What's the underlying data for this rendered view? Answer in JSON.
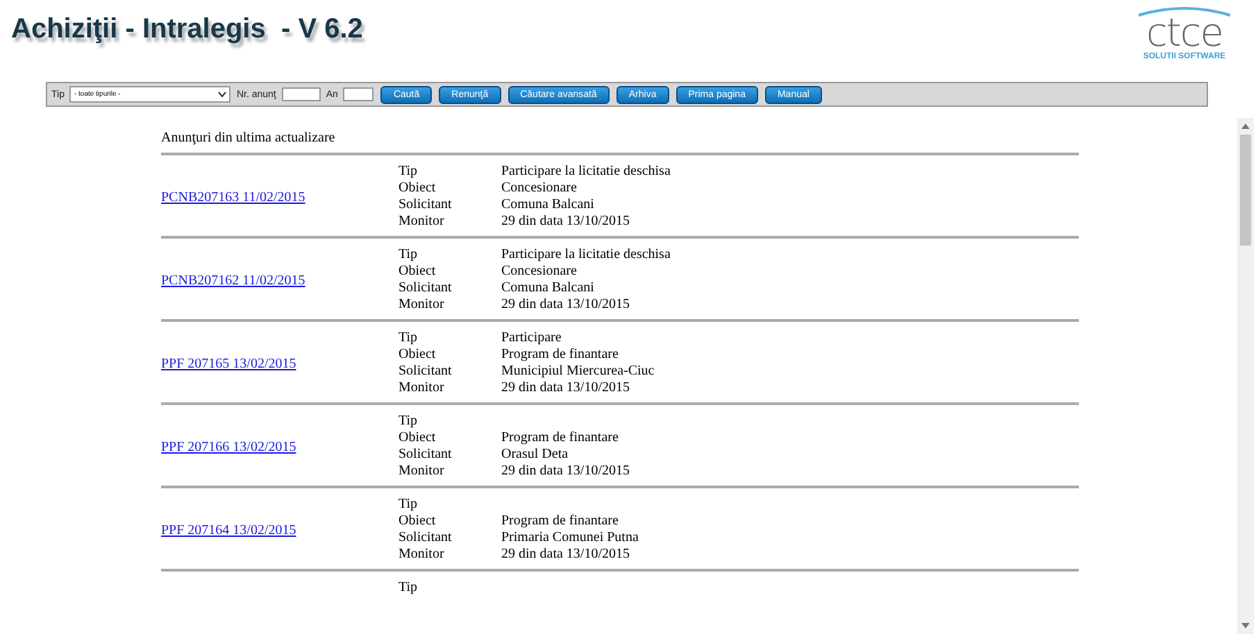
{
  "header": {
    "title": "Achiziţii - Intralegis  - V 6.2",
    "logo": {
      "name": "ctce",
      "tagline": "SOLUTII SOFTWARE"
    }
  },
  "toolbar": {
    "type_label": "Tip",
    "type_value": "- toate tipurile -",
    "number_label": "Nr. anunţ",
    "year_label": "An",
    "buttons": [
      "Caută",
      "Renunţă",
      "Căutare avansată",
      "Arhiva",
      "Prima pagina",
      "Manual"
    ]
  },
  "content": {
    "heading": "Anunţuri din ultima actualizare",
    "entries": [
      {
        "link": "PCNB207163 11/02/2015",
        "fields": [
          {
            "label": "Tip",
            "value": "Participare la licitatie deschisa"
          },
          {
            "label": "Obiect",
            "value": "Concesionare"
          },
          {
            "label": "Solicitant",
            "value": "Comuna Balcani"
          },
          {
            "label": "Monitor",
            "value": "29 din data 13/10/2015"
          }
        ]
      },
      {
        "link": "PCNB207162 11/02/2015",
        "fields": [
          {
            "label": "Tip",
            "value": "Participare la licitatie deschisa"
          },
          {
            "label": "Obiect",
            "value": "Concesionare"
          },
          {
            "label": "Solicitant",
            "value": "Comuna Balcani"
          },
          {
            "label": "Monitor",
            "value": "29 din data 13/10/2015"
          }
        ]
      },
      {
        "link": "PPF 207165 13/02/2015",
        "fields": [
          {
            "label": "Tip",
            "value": "Participare"
          },
          {
            "label": "Obiect",
            "value": "Program de finantare"
          },
          {
            "label": "Solicitant",
            "value": "Municipiul Miercurea-Ciuc"
          },
          {
            "label": "Monitor",
            "value": "29 din data 13/10/2015"
          }
        ]
      },
      {
        "link": "PPF 207166 13/02/2015",
        "fields": [
          {
            "label": "Tip"
          },
          {
            "label": "Obiect",
            "value": "Program de finantare"
          },
          {
            "label": "Solicitant",
            "value": "Orasul Deta"
          },
          {
            "label": "Monitor",
            "value": "29 din data 13/10/2015"
          }
        ]
      },
      {
        "link": "PPF 207164 13/02/2015",
        "fields": [
          {
            "label": "Tip"
          },
          {
            "label": "Obiect",
            "value": "Program de finantare"
          },
          {
            "label": "Solicitant",
            "value": "Primaria Comunei Putna"
          },
          {
            "label": "Monitor",
            "value": "29 din data 13/10/2015"
          }
        ]
      },
      {
        "fields": [
          {
            "label": "Tip"
          }
        ]
      }
    ]
  }
}
